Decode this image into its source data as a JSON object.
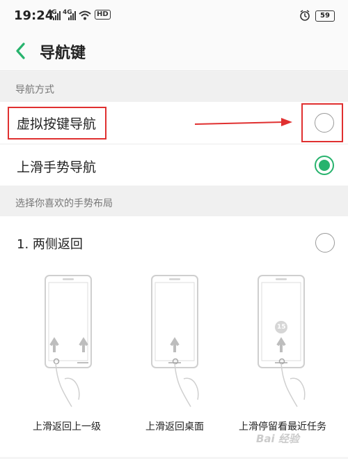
{
  "status_bar": {
    "time": "19:24",
    "sim1": "4G",
    "sim2": "4G",
    "hd": "HD",
    "battery": "59"
  },
  "header": {
    "title": "导航键"
  },
  "nav_section": {
    "label": "导航方式",
    "options": [
      {
        "label": "虚拟按键导航",
        "selected": false
      },
      {
        "label": "上滑手势导航",
        "selected": true
      }
    ]
  },
  "layout_section": {
    "label": "选择你喜欢的手势布局",
    "options": [
      {
        "label": "1. 两侧返回",
        "selected": false
      }
    ],
    "illustrations": [
      {
        "caption": "上滑返回上一级"
      },
      {
        "caption": "上滑返回桌面"
      },
      {
        "caption": "上滑停留看最近任务",
        "badge": "15"
      }
    ]
  },
  "watermark": "Bai 经验",
  "colors": {
    "accent_green": "#27b36d",
    "highlight_red": "#e03030"
  }
}
